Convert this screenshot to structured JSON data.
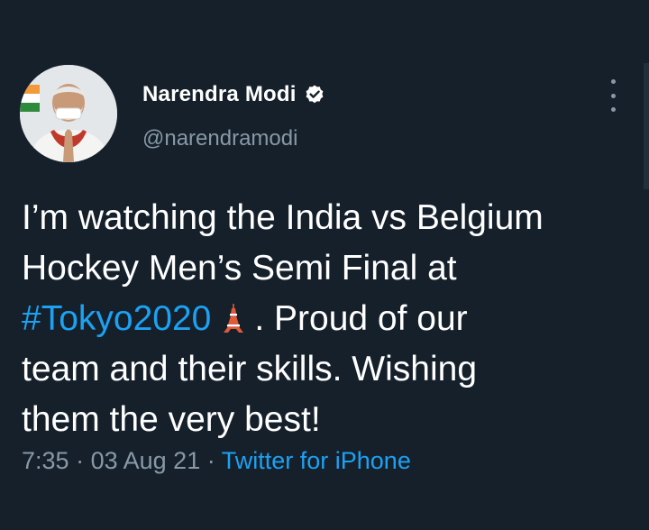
{
  "author": {
    "display_name": "Narendra Modi",
    "handle": "@narendramodi",
    "verified_icon": "verified-badge-icon",
    "avatar_icon": "avatar"
  },
  "tweet": {
    "line1": "I’m watching the India vs Belgium",
    "line2": "Hockey Men’s Semi Final at",
    "hashtag": "#Tokyo2020",
    "emoji": "tokyo-tower-emoji",
    "line3_rest": ". Proud of our",
    "line4": "team and their skills. Wishing",
    "line5": "them the very best!"
  },
  "meta": {
    "time": "7:35",
    "separator1": "·",
    "date": "03 Aug 21",
    "separator2": "·",
    "source": "Twitter for iPhone"
  },
  "colors": {
    "background": "#15202b",
    "text": "#ffffff",
    "secondary": "#8899a6",
    "link": "#1da1f2"
  }
}
